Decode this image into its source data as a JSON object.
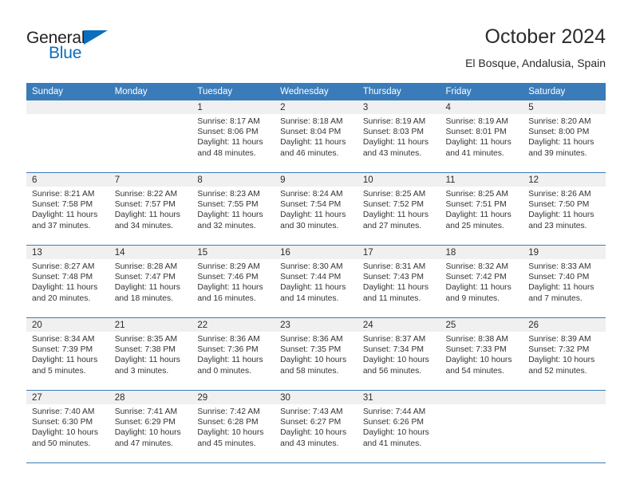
{
  "brand": {
    "name_part1": "General",
    "name_part2": "Blue",
    "accent_color": "#0a6ebd"
  },
  "header": {
    "title": "October 2024",
    "subtitle": "El Bosque, Andalusia, Spain"
  },
  "theme": {
    "header_bg": "#3a7cb9",
    "date_strip_bg": "#f0f0f0",
    "grid_line": "#3a7cb9"
  },
  "weekdays": [
    "Sunday",
    "Monday",
    "Tuesday",
    "Wednesday",
    "Thursday",
    "Friday",
    "Saturday"
  ],
  "labels": {
    "sunrise_prefix": "Sunrise:",
    "sunset_prefix": "Sunset:",
    "daylight_prefix": "Daylight:"
  },
  "weeks": [
    [
      {
        "day": ""
      },
      {
        "day": ""
      },
      {
        "day": "1",
        "sunrise": "Sunrise: 8:17 AM",
        "sunset": "Sunset: 8:06 PM",
        "daylight_l1": "Daylight: 11 hours",
        "daylight_l2": "and 48 minutes."
      },
      {
        "day": "2",
        "sunrise": "Sunrise: 8:18 AM",
        "sunset": "Sunset: 8:04 PM",
        "daylight_l1": "Daylight: 11 hours",
        "daylight_l2": "and 46 minutes."
      },
      {
        "day": "3",
        "sunrise": "Sunrise: 8:19 AM",
        "sunset": "Sunset: 8:03 PM",
        "daylight_l1": "Daylight: 11 hours",
        "daylight_l2": "and 43 minutes."
      },
      {
        "day": "4",
        "sunrise": "Sunrise: 8:19 AM",
        "sunset": "Sunset: 8:01 PM",
        "daylight_l1": "Daylight: 11 hours",
        "daylight_l2": "and 41 minutes."
      },
      {
        "day": "5",
        "sunrise": "Sunrise: 8:20 AM",
        "sunset": "Sunset: 8:00 PM",
        "daylight_l1": "Daylight: 11 hours",
        "daylight_l2": "and 39 minutes."
      }
    ],
    [
      {
        "day": "6",
        "sunrise": "Sunrise: 8:21 AM",
        "sunset": "Sunset: 7:58 PM",
        "daylight_l1": "Daylight: 11 hours",
        "daylight_l2": "and 37 minutes."
      },
      {
        "day": "7",
        "sunrise": "Sunrise: 8:22 AM",
        "sunset": "Sunset: 7:57 PM",
        "daylight_l1": "Daylight: 11 hours",
        "daylight_l2": "and 34 minutes."
      },
      {
        "day": "8",
        "sunrise": "Sunrise: 8:23 AM",
        "sunset": "Sunset: 7:55 PM",
        "daylight_l1": "Daylight: 11 hours",
        "daylight_l2": "and 32 minutes."
      },
      {
        "day": "9",
        "sunrise": "Sunrise: 8:24 AM",
        "sunset": "Sunset: 7:54 PM",
        "daylight_l1": "Daylight: 11 hours",
        "daylight_l2": "and 30 minutes."
      },
      {
        "day": "10",
        "sunrise": "Sunrise: 8:25 AM",
        "sunset": "Sunset: 7:52 PM",
        "daylight_l1": "Daylight: 11 hours",
        "daylight_l2": "and 27 minutes."
      },
      {
        "day": "11",
        "sunrise": "Sunrise: 8:25 AM",
        "sunset": "Sunset: 7:51 PM",
        "daylight_l1": "Daylight: 11 hours",
        "daylight_l2": "and 25 minutes."
      },
      {
        "day": "12",
        "sunrise": "Sunrise: 8:26 AM",
        "sunset": "Sunset: 7:50 PM",
        "daylight_l1": "Daylight: 11 hours",
        "daylight_l2": "and 23 minutes."
      }
    ],
    [
      {
        "day": "13",
        "sunrise": "Sunrise: 8:27 AM",
        "sunset": "Sunset: 7:48 PM",
        "daylight_l1": "Daylight: 11 hours",
        "daylight_l2": "and 20 minutes."
      },
      {
        "day": "14",
        "sunrise": "Sunrise: 8:28 AM",
        "sunset": "Sunset: 7:47 PM",
        "daylight_l1": "Daylight: 11 hours",
        "daylight_l2": "and 18 minutes."
      },
      {
        "day": "15",
        "sunrise": "Sunrise: 8:29 AM",
        "sunset": "Sunset: 7:46 PM",
        "daylight_l1": "Daylight: 11 hours",
        "daylight_l2": "and 16 minutes."
      },
      {
        "day": "16",
        "sunrise": "Sunrise: 8:30 AM",
        "sunset": "Sunset: 7:44 PM",
        "daylight_l1": "Daylight: 11 hours",
        "daylight_l2": "and 14 minutes."
      },
      {
        "day": "17",
        "sunrise": "Sunrise: 8:31 AM",
        "sunset": "Sunset: 7:43 PM",
        "daylight_l1": "Daylight: 11 hours",
        "daylight_l2": "and 11 minutes."
      },
      {
        "day": "18",
        "sunrise": "Sunrise: 8:32 AM",
        "sunset": "Sunset: 7:42 PM",
        "daylight_l1": "Daylight: 11 hours",
        "daylight_l2": "and 9 minutes."
      },
      {
        "day": "19",
        "sunrise": "Sunrise: 8:33 AM",
        "sunset": "Sunset: 7:40 PM",
        "daylight_l1": "Daylight: 11 hours",
        "daylight_l2": "and 7 minutes."
      }
    ],
    [
      {
        "day": "20",
        "sunrise": "Sunrise: 8:34 AM",
        "sunset": "Sunset: 7:39 PM",
        "daylight_l1": "Daylight: 11 hours",
        "daylight_l2": "and 5 minutes."
      },
      {
        "day": "21",
        "sunrise": "Sunrise: 8:35 AM",
        "sunset": "Sunset: 7:38 PM",
        "daylight_l1": "Daylight: 11 hours",
        "daylight_l2": "and 3 minutes."
      },
      {
        "day": "22",
        "sunrise": "Sunrise: 8:36 AM",
        "sunset": "Sunset: 7:36 PM",
        "daylight_l1": "Daylight: 11 hours",
        "daylight_l2": "and 0 minutes."
      },
      {
        "day": "23",
        "sunrise": "Sunrise: 8:36 AM",
        "sunset": "Sunset: 7:35 PM",
        "daylight_l1": "Daylight: 10 hours",
        "daylight_l2": "and 58 minutes."
      },
      {
        "day": "24",
        "sunrise": "Sunrise: 8:37 AM",
        "sunset": "Sunset: 7:34 PM",
        "daylight_l1": "Daylight: 10 hours",
        "daylight_l2": "and 56 minutes."
      },
      {
        "day": "25",
        "sunrise": "Sunrise: 8:38 AM",
        "sunset": "Sunset: 7:33 PM",
        "daylight_l1": "Daylight: 10 hours",
        "daylight_l2": "and 54 minutes."
      },
      {
        "day": "26",
        "sunrise": "Sunrise: 8:39 AM",
        "sunset": "Sunset: 7:32 PM",
        "daylight_l1": "Daylight: 10 hours",
        "daylight_l2": "and 52 minutes."
      }
    ],
    [
      {
        "day": "27",
        "sunrise": "Sunrise: 7:40 AM",
        "sunset": "Sunset: 6:30 PM",
        "daylight_l1": "Daylight: 10 hours",
        "daylight_l2": "and 50 minutes."
      },
      {
        "day": "28",
        "sunrise": "Sunrise: 7:41 AM",
        "sunset": "Sunset: 6:29 PM",
        "daylight_l1": "Daylight: 10 hours",
        "daylight_l2": "and 47 minutes."
      },
      {
        "day": "29",
        "sunrise": "Sunrise: 7:42 AM",
        "sunset": "Sunset: 6:28 PM",
        "daylight_l1": "Daylight: 10 hours",
        "daylight_l2": "and 45 minutes."
      },
      {
        "day": "30",
        "sunrise": "Sunrise: 7:43 AM",
        "sunset": "Sunset: 6:27 PM",
        "daylight_l1": "Daylight: 10 hours",
        "daylight_l2": "and 43 minutes."
      },
      {
        "day": "31",
        "sunrise": "Sunrise: 7:44 AM",
        "sunset": "Sunset: 6:26 PM",
        "daylight_l1": "Daylight: 10 hours",
        "daylight_l2": "and 41 minutes."
      },
      {
        "day": ""
      },
      {
        "day": ""
      }
    ]
  ]
}
